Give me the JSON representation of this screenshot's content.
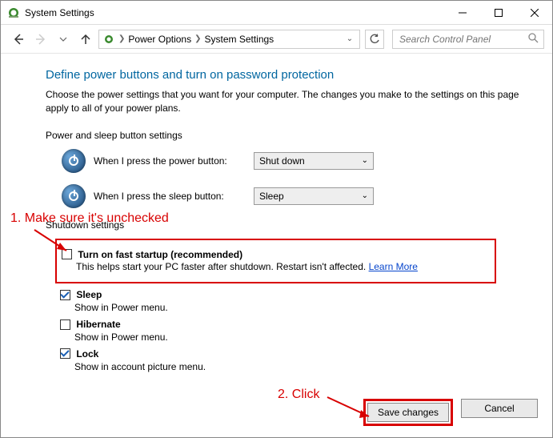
{
  "window": {
    "title": "System Settings"
  },
  "breadcrumb": {
    "item1": "Power Options",
    "item2": "System Settings"
  },
  "search": {
    "placeholder": "Search Control Panel"
  },
  "page": {
    "heading": "Define power buttons and turn on password protection",
    "description": "Choose the power settings that you want for your computer. The changes you make to the settings on this page apply to all of your power plans.",
    "section_power_sleep": "Power and sleep button settings",
    "power_button_label": "When I press the power button:",
    "power_button_value": "Shut down",
    "sleep_button_label": "When I press the sleep button:",
    "sleep_button_value": "Sleep",
    "section_shutdown": "Shutdown settings",
    "fast_startup": {
      "label": "Turn on fast startup (recommended)",
      "desc_prefix": "This helps start your PC faster after shutdown. Restart isn't affected. ",
      "learn_more": "Learn More"
    },
    "sleep": {
      "label": "Sleep",
      "desc": "Show in Power menu."
    },
    "hibernate": {
      "label": "Hibernate",
      "desc": "Show in Power menu."
    },
    "lock": {
      "label": "Lock",
      "desc": "Show in account picture menu."
    }
  },
  "buttons": {
    "save": "Save changes",
    "cancel": "Cancel"
  },
  "annotations": {
    "step1": "1. Make sure it's unchecked",
    "step2": "2. Click"
  }
}
